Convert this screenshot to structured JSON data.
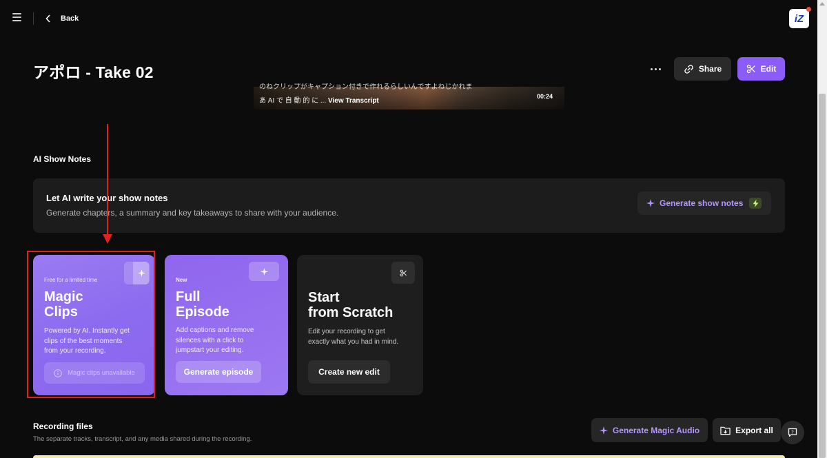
{
  "nav": {
    "back_label": "Back",
    "logo_text": "iZ"
  },
  "header": {
    "title": "アポロ - Take 02",
    "share_label": "Share",
    "edit_label": "Edit"
  },
  "video": {
    "caption_top": "のねクリップがキャプション付きで作れるらしいんですよねじかれま",
    "caption_prefix": "あ AI で 自 動 的 に ...",
    "view_transcript": "View Transcript",
    "timestamp": "00:24"
  },
  "show_notes": {
    "section_label": "AI Show Notes",
    "panel_title": "Let AI write your show notes",
    "panel_subtitle": "Generate chapters, a summary and key takeaways to share with your audience.",
    "generate_label": "Generate show notes"
  },
  "cards": {
    "magic": {
      "tag": "Free for a limited time",
      "title_line1": "Magic",
      "title_line2": "Clips",
      "desc_line1": "Powered by AI. Instantly get",
      "desc_line2": "clips of the best moments",
      "desc_line3": "from your recording.",
      "unavailable_label": "Magic clips unavailable"
    },
    "full": {
      "tag": "New",
      "title_line1": "Full",
      "title_line2": "Episode",
      "desc_line1": "Add captions and remove",
      "desc_line2": "silences with a click to",
      "desc_line3": "jumpstart your editing.",
      "button_label": "Generate episode"
    },
    "scratch": {
      "title_line1": "Start",
      "title_line2": "from Scratch",
      "desc_line1": "Edit your recording to get",
      "desc_line2": "exactly what you had in mind.",
      "button_label": "Create new edit"
    }
  },
  "recording": {
    "title": "Recording files",
    "subtitle": "The separate tracks, transcript, and any media shared during the recording.",
    "generate_audio_label": "Generate Magic Audio",
    "export_label": "Export all"
  },
  "colors": {
    "accent": "#8b5cf6",
    "accent_text": "#b696ff",
    "annotation": "#e2211c",
    "background": "#0c0c0c"
  }
}
